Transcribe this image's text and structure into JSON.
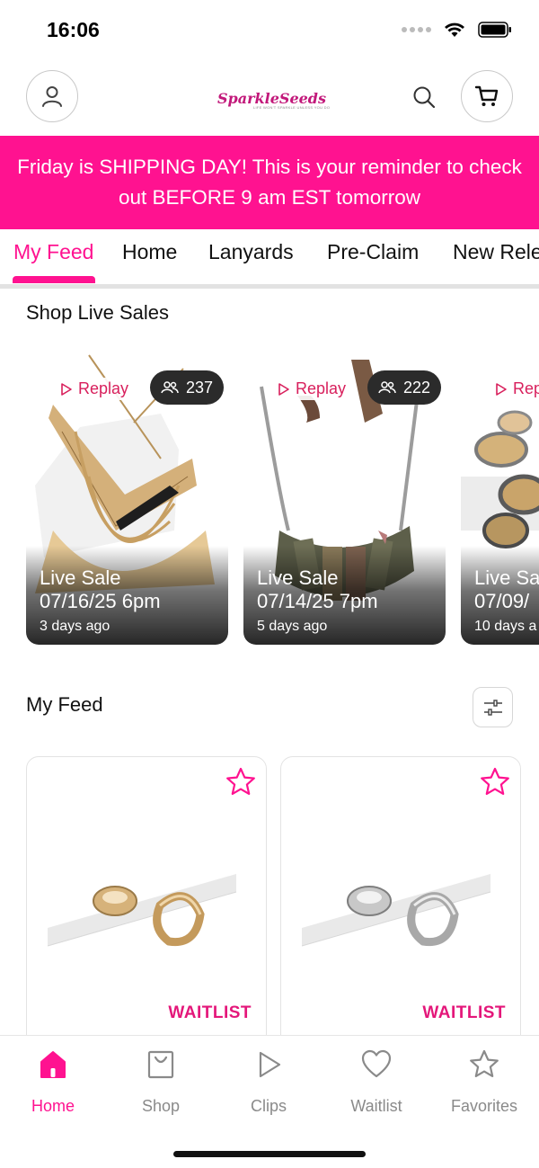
{
  "status_bar": {
    "time": "16:06"
  },
  "header": {
    "logo_text": "SparkleSeeds",
    "logo_tagline": "LIFE WON'T SPARKLE UNLESS YOU DO"
  },
  "banner": {
    "text": "Friday is SHIPPING DAY!  This is your reminder to check out BEFORE 9 am EST tomorrow"
  },
  "tabs": [
    {
      "label": "My Feed",
      "active": true
    },
    {
      "label": "Home"
    },
    {
      "label": "Lanyards"
    },
    {
      "label": "Pre-Claim"
    },
    {
      "label": "New Rele"
    }
  ],
  "live_sales": {
    "title": "Shop Live Sales",
    "cards": [
      {
        "replay_label": "Replay",
        "viewers": "237",
        "title": "Live Sale",
        "date": "07/16/25 6pm",
        "ago": "3 days ago"
      },
      {
        "replay_label": "Replay",
        "viewers": "222",
        "title": "Live Sale",
        "date": "07/14/25 7pm",
        "ago": "5 days ago"
      },
      {
        "replay_label": "Rep",
        "title": "Live Sa",
        "date": "07/09/",
        "ago": "10 days a"
      }
    ]
  },
  "feed": {
    "title": "My Feed",
    "products": [
      {
        "label": "WAITLIST",
        "finish": "gold"
      },
      {
        "label": "WAITLIST",
        "finish": "silver"
      }
    ]
  },
  "bottom_nav": [
    {
      "label": "Home",
      "icon": "home-icon",
      "active": true
    },
    {
      "label": "Shop",
      "icon": "shopping-bag-icon"
    },
    {
      "label": "Clips",
      "icon": "play-icon"
    },
    {
      "label": "Waitlist",
      "icon": "heart-icon"
    },
    {
      "label": "Favorites",
      "icon": "star-icon"
    }
  ],
  "colors": {
    "accent": "#ff1290",
    "replay": "#d81f5c",
    "waitlist": "#e4177a"
  }
}
